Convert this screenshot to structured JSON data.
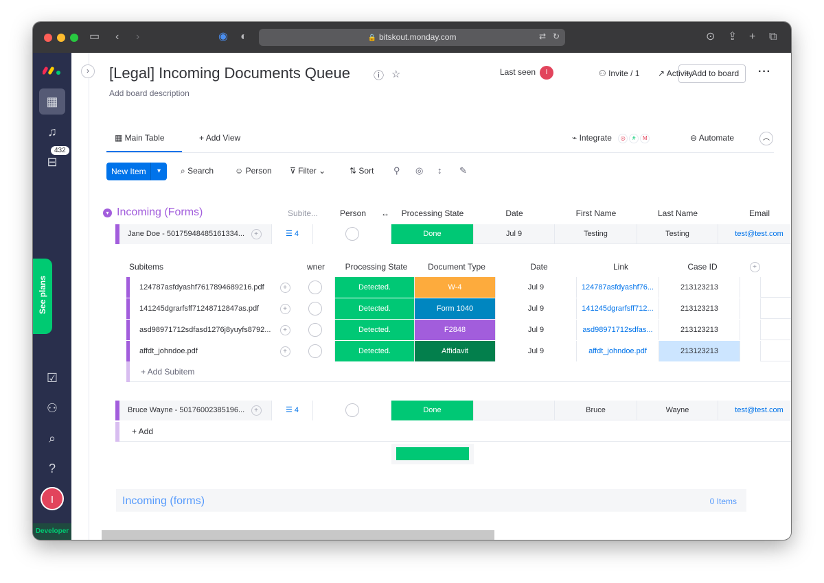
{
  "browser": {
    "url": "bitskout.monday.com"
  },
  "nav": {
    "inbox_count": "432",
    "see_plans": "See plans",
    "avatar_initial": "I",
    "developer_label": "Developer"
  },
  "board": {
    "title": "[Legal] Incoming Documents Queue",
    "description": "Add board description",
    "last_seen": "Last seen",
    "last_seen_initial": "I",
    "invite": "Invite / 1",
    "activity": "Activity",
    "add_to_board": "Add to board"
  },
  "tabs": {
    "main_table": "Main Table",
    "add_view": "Add View",
    "integrate": "Integrate",
    "automate": "Automate"
  },
  "toolbar": {
    "new_item": "New Item",
    "search": "Search",
    "person": "Person",
    "filter": "Filter",
    "sort": "Sort"
  },
  "group1": {
    "title": "Incoming (Forms)",
    "columns": {
      "subitems": "Subite...",
      "person": "Person",
      "processing_state": "Processing State",
      "date": "Date",
      "first_name": "First Name",
      "last_name": "Last Name",
      "email": "Email"
    },
    "items": [
      {
        "name": "Jane Doe - 50175948485161334...",
        "subitem_count": "4",
        "status": "Done",
        "date": "Jul 9",
        "first_name": "Testing",
        "last_name": "Testing",
        "email": "test@test.com"
      },
      {
        "name": "Bruce Wayne - 50176002385196...",
        "subitem_count": "4",
        "status": "Done",
        "date": "",
        "first_name": "Bruce",
        "last_name": "Wayne",
        "email": "test@test.com"
      }
    ],
    "add_item": "+ Add"
  },
  "subitems": {
    "title": "Subitems",
    "columns": {
      "owner": "wner",
      "processing_state": "Processing State",
      "document_type": "Document Type",
      "date": "Date",
      "link": "Link",
      "case_id": "Case ID"
    },
    "rows": [
      {
        "name": "124787asfdyashf7617894689216.pdf",
        "state": "Detected.",
        "doc_type": "W-4",
        "doc_color": "#fdab3d",
        "date": "Jul 9",
        "link": "124787asfdyashf76...",
        "case_id": "213123213"
      },
      {
        "name": "141245dgrarfsff71248712847as.pdf",
        "state": "Detected.",
        "doc_type": "Form 1040",
        "doc_color": "#0086c0",
        "date": "Jul 9",
        "link": "141245dgrarfsff712...",
        "case_id": "213123213"
      },
      {
        "name": "asd98971712sdfasd1276j8yuyfs8792...",
        "state": "Detected.",
        "doc_type": "F2848",
        "doc_color": "#a25ddc",
        "date": "Jul 9",
        "link": "asd98971712sdfas...",
        "case_id": "213123213"
      },
      {
        "name": "affdt_johndoe.pdf",
        "state": "Detected.",
        "doc_type": "Affidavit",
        "doc_color": "#037f4c",
        "date": "Jul 9",
        "link": "affdt_johndoe.pdf",
        "case_id": "213123213"
      }
    ],
    "add_subitem": "+ Add Subitem"
  },
  "group2": {
    "title": "Incoming (forms)",
    "count": "0 Items"
  },
  "colors": {
    "done": "#00c875",
    "detected": "#00c875",
    "group_purple": "#a25ddc",
    "primary": "#0073ea",
    "nav_bg": "#292f4c"
  }
}
